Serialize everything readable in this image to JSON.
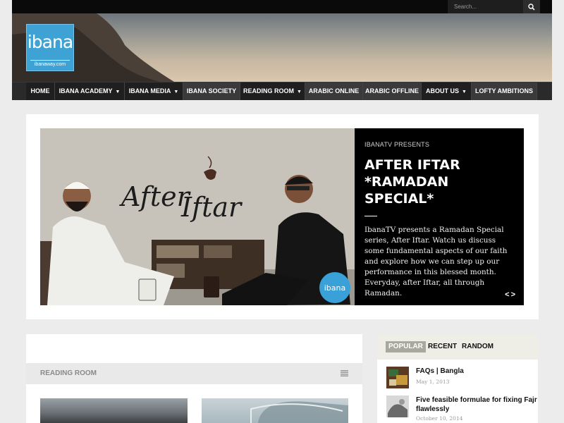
{
  "search": {
    "placeholder": "Search..."
  },
  "logo": {
    "word": "ibana",
    "sub": "ibanaway.com"
  },
  "nav": {
    "items": [
      {
        "label": "HOME",
        "caret": false
      },
      {
        "label": "IBANA ACADEMY",
        "caret": true
      },
      {
        "label": "IBANA MEDIA",
        "caret": true
      },
      {
        "label": "IBANA SOCIETY",
        "caret": false
      },
      {
        "label": "READING ROOM",
        "caret": true
      },
      {
        "label": "ARABIC ONLINE",
        "caret": false
      },
      {
        "label": "ARABIC OFFLINE",
        "caret": false
      },
      {
        "label": "ABOUT US",
        "caret": true
      },
      {
        "label": "LOFTY AMBITIONS",
        "caret": false
      }
    ]
  },
  "slider": {
    "art_text_1": "After",
    "art_text_2": "Iftar",
    "badge": "ibana",
    "kicker": "IBANATV PRESENTS",
    "title": "AFTER IFTAR *RAMADAN SPECIAL*",
    "body": "IbanaTV presents a Ramadan Special series, After Iftar. Watch us discuss some fundamental aspects of our faith and explore how we can step up our performance in this blessed month. Everyday, after Iftar, all through Ramadan.",
    "arrows": "<>"
  },
  "main": {
    "section_title": "READING ROOM"
  },
  "sidebar": {
    "tabs": [
      "POPULAR",
      "RECENT",
      "RANDOM"
    ],
    "active_tab": "POPULAR",
    "posts": [
      {
        "title": "FAQs | Bangla",
        "date": "May 1, 2013"
      },
      {
        "title": "Five feasible formulae for fixing Fajr flawlessly",
        "date": "October 10, 2014"
      }
    ]
  },
  "colors": {
    "logo_blue": "#3fa2d5",
    "nav_bg": "#2a2a2a",
    "caption_bg": "#000000",
    "active_tab": "#a8a89e"
  }
}
